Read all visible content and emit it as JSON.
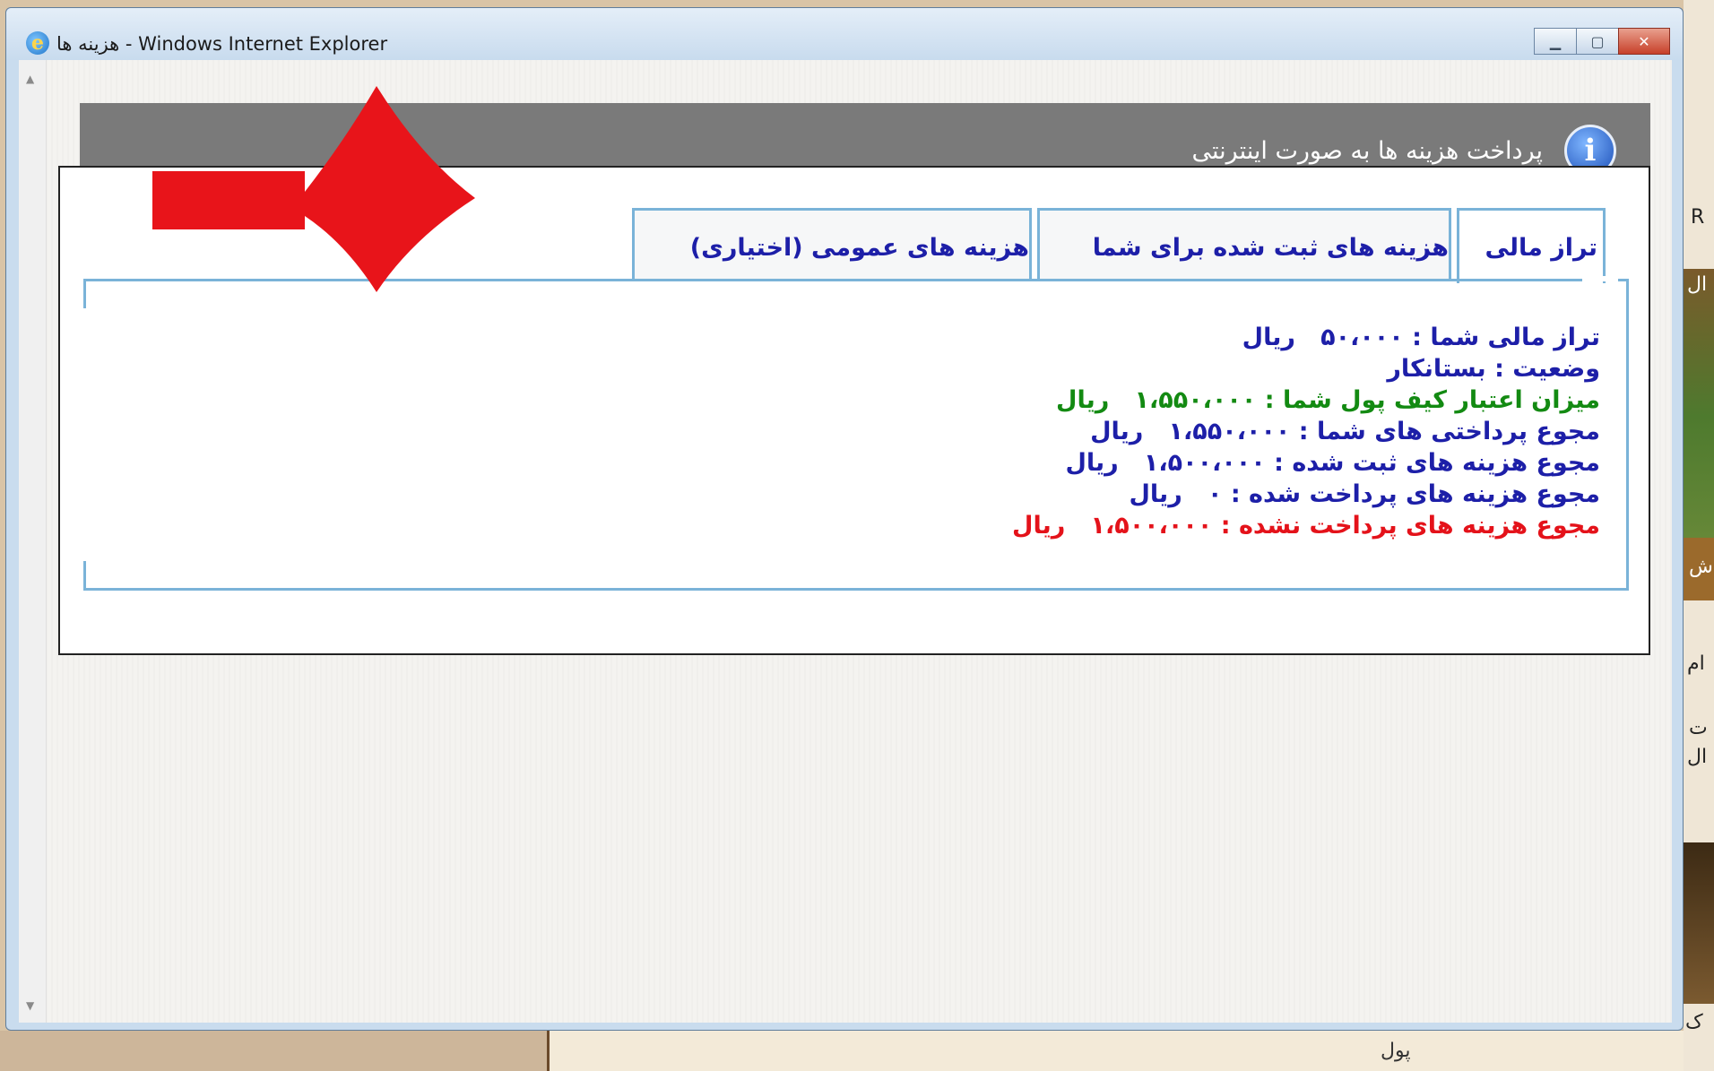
{
  "window": {
    "title": "هزینه ها - Windows Internet Explorer",
    "minimize_icon": "minimize-icon",
    "maximize_icon": "maximize-icon",
    "close_icon": "close-icon"
  },
  "header": {
    "title": "پرداخت هزینه ها به صورت اینترنتی",
    "icon": "info-icon"
  },
  "tabs": [
    {
      "label": "تراز مالی",
      "active": true
    },
    {
      "label": "هزینه های ثبت شده برای شما",
      "active": false
    },
    {
      "label": "هزینه های عمومی (اختیاری)",
      "active": false
    }
  ],
  "summary": {
    "balance": "تراز مالی شما : ۵۰،۰۰۰   ریال",
    "status": "وضعیت : بستانکار",
    "wallet_credit": "میزان اعتبار کیف پول شما : ۱،۵۵۰،۰۰۰   ریال",
    "total_payments": "مجوع پرداختی های شما : ۱،۵۵۰،۰۰۰   ریال",
    "total_registered": "مجوع هزینه های ثبت شده : ۱،۵۰۰،۰۰۰   ریال",
    "total_paid": "مجوع هزینه های پرداخت شده : ۰   ریال",
    "total_unpaid": "مجوع هزینه های پرداخت نشده : ۱،۵۰۰،۰۰۰   ریال"
  },
  "colors": {
    "text_blue": "#1d1fa8",
    "text_green": "#138a12",
    "text_red": "#e4121a",
    "tab_border": "#7ab3d8",
    "header_gray": "#7a7a7a",
    "arrow_red": "#e8141a"
  },
  "background_page": {
    "bottom_text": "پول",
    "right_fragments": [
      "R",
      "ال",
      "ش",
      "ام",
      "ت",
      "ال",
      "ک"
    ]
  },
  "annotation": {
    "arrow_icon": "red-arrow-icon"
  }
}
